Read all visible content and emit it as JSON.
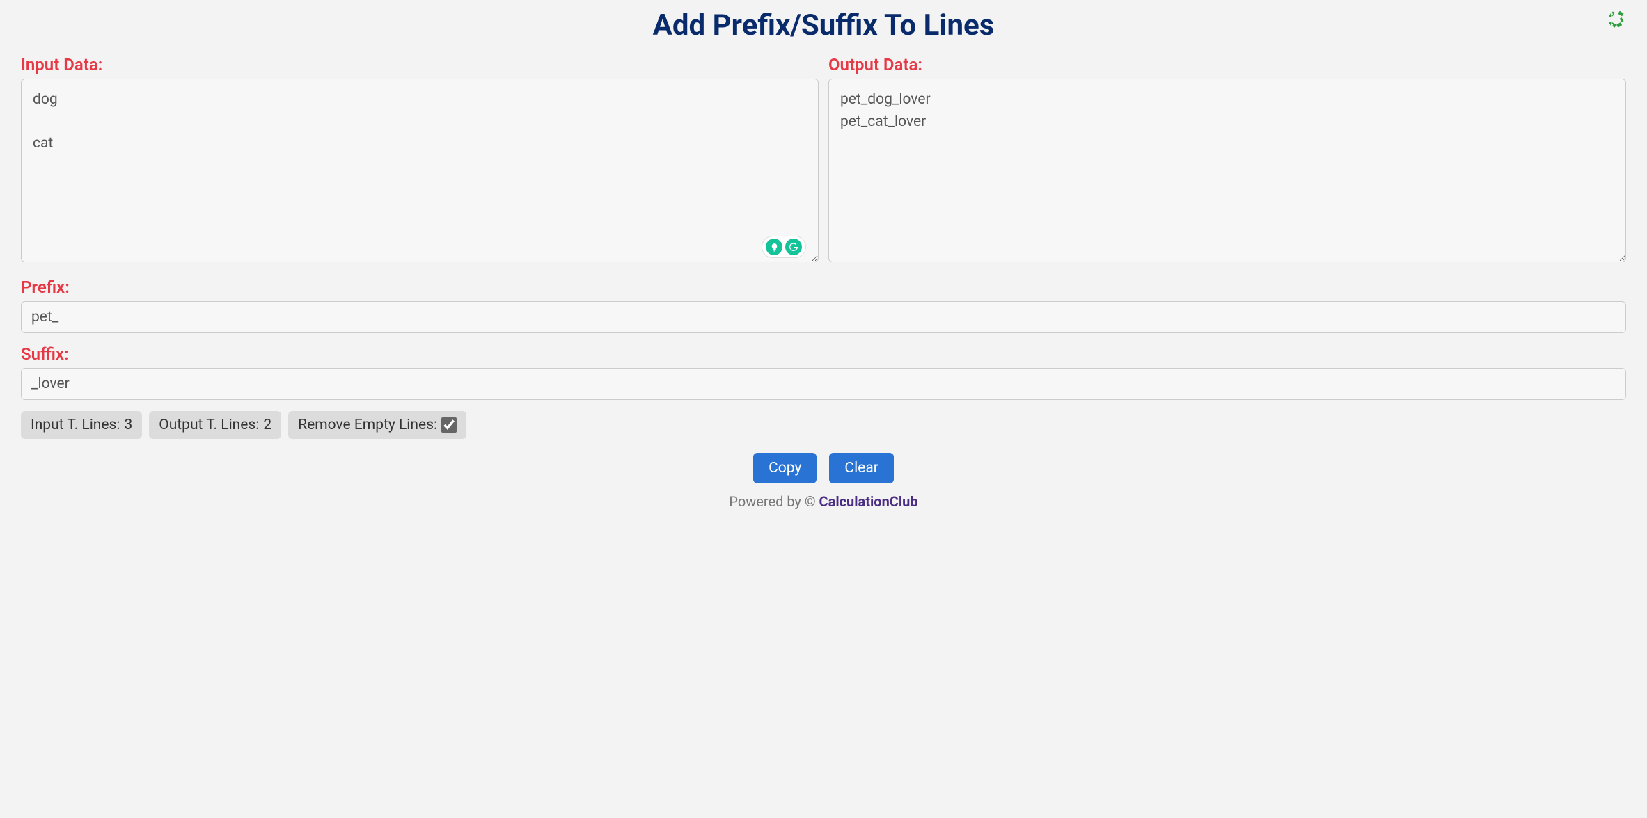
{
  "title": "Add Prefix/Suffix To Lines",
  "labels": {
    "input": "Input Data:",
    "output": "Output Data:",
    "prefix": "Prefix:",
    "suffix": "Suffix:"
  },
  "input_value": "dog\n\ncat",
  "output_value": "pet_dog_lover\npet_cat_lover",
  "prefix_value": "pet_",
  "suffix_value": "_lover",
  "stats": {
    "input_lines_label": "Input T. Lines: ",
    "input_lines_count": "3",
    "output_lines_label": "Output T. Lines: ",
    "output_lines_count": "2",
    "remove_empty_label": "Remove Empty Lines:",
    "remove_empty_checked": true
  },
  "buttons": {
    "copy": "Copy",
    "clear": "Clear"
  },
  "footer": {
    "prefix": "Powered by © ",
    "link_text": "CalculationClub"
  }
}
